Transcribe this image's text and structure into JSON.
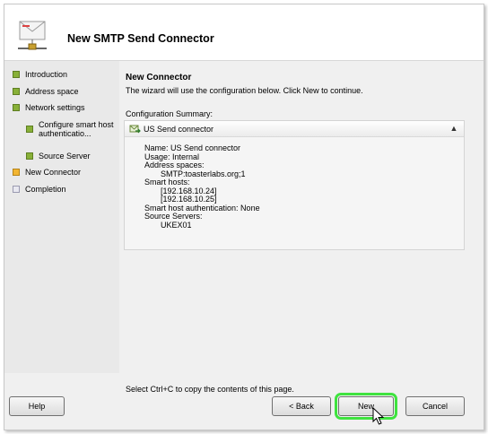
{
  "window": {
    "title": "New SMTP Send Connector"
  },
  "sidebar": {
    "steps": [
      {
        "label": "Introduction",
        "state": "done"
      },
      {
        "label": "Address space",
        "state": "done"
      },
      {
        "label": "Network settings",
        "state": "done"
      },
      {
        "label": "Configure smart host authenticatio...",
        "state": "done",
        "sub": true
      },
      {
        "label": "Source Server",
        "state": "done",
        "sub": true
      },
      {
        "label": "New Connector",
        "state": "current"
      },
      {
        "label": "Completion",
        "state": "pending"
      }
    ]
  },
  "main": {
    "heading": "New Connector",
    "description": "The wizard will use the configuration below.  Click New to continue.",
    "summary_label": "Configuration Summary:",
    "summary": {
      "connector_name": "US Send connector",
      "lines": [
        "Name: US Send connector",
        "Usage: Internal",
        "Address spaces:",
        "SMTP:toasterlabs.org;1",
        "Smart hosts:",
        "[192.168.10.24]",
        "[192.168.10.25]",
        "Smart host authentication: None",
        "Source Servers:",
        "UKEX01"
      ]
    },
    "footer_note": "Select Ctrl+C to copy the contents of this page."
  },
  "buttons": {
    "help": "Help",
    "back": "< Back",
    "new": "New",
    "cancel": "Cancel"
  },
  "colors": {
    "step_done": "#88b038",
    "step_current": "#f2b532",
    "highlight": "#3fe33f"
  }
}
